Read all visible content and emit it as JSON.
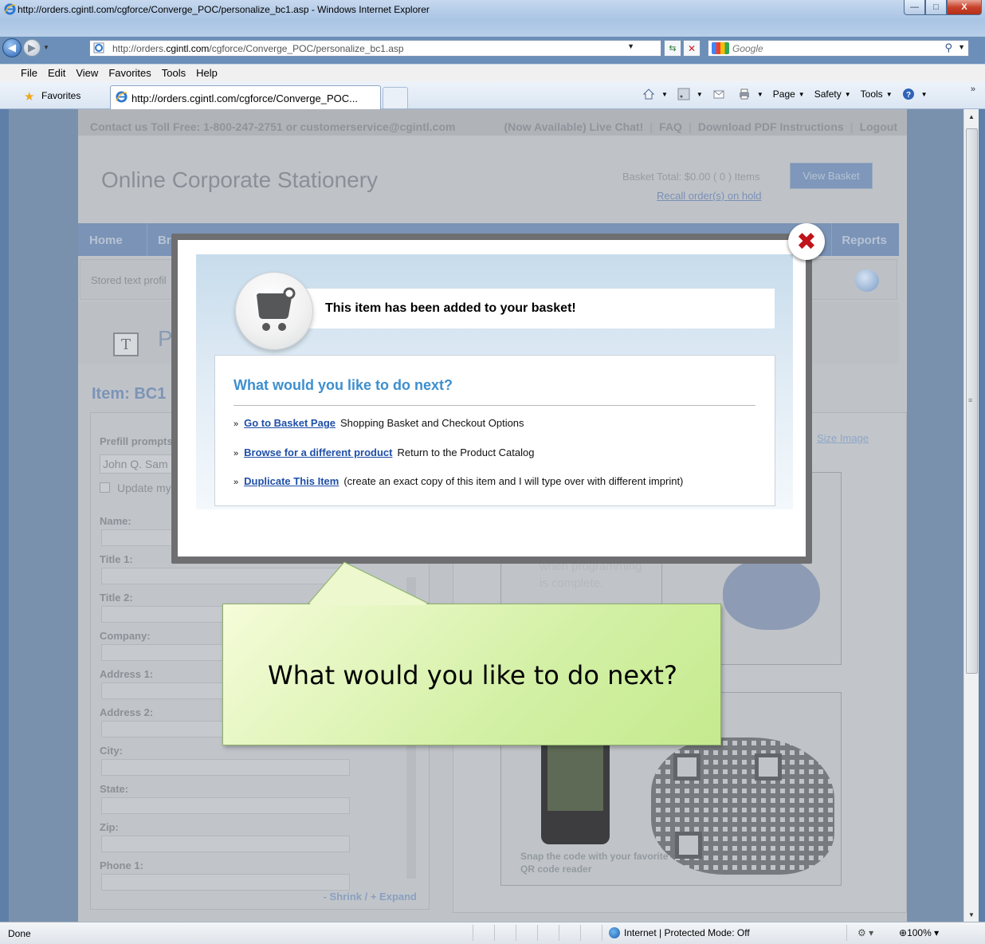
{
  "window": {
    "title": "http://orders.cgintl.com/cgforce/Converge_POC/personalize_bc1.asp - Windows Internet Explorer",
    "minimize": "—",
    "maximize": "□",
    "close": "X"
  },
  "address_bar": {
    "url_prefix": "http://orders.",
    "url_domain": "cgintl.com",
    "url_path": "/cgforce/Converge_POC/personalize_bc1.asp",
    "search_placeholder": "Google"
  },
  "menu": [
    "File",
    "Edit",
    "View",
    "Favorites",
    "Tools",
    "Help"
  ],
  "favorites_bar": {
    "favorites_label": "Favorites",
    "tab_title": "http://orders.cgintl.com/cgforce/Converge_POC...",
    "page_label": "Page",
    "safety_label": "Safety",
    "tools_label": "Tools"
  },
  "site": {
    "contact": "Contact us Toll Free: 1-800-247-2751 or customerservice@cgintl.com",
    "links": [
      "(Now Available) Live Chat!",
      "FAQ",
      "Download PDF Instructions",
      "Logout"
    ],
    "brand": "Online Corporate Stationery",
    "basket_total": "Basket Total: $0.00  ( 0 ) Items",
    "recall": "Recall order(s) on hold",
    "view_basket": "View Basket",
    "nav_home": "Home",
    "nav_b": "Br",
    "nav_reports": "Reports",
    "stored_text": "Stored text profil",
    "product_letter": "P",
    "item_label": "Item:  BC1",
    "prefill_label": "Prefill prompts",
    "prefill_value": "John Q. Sam",
    "update_label": "Update my",
    "fields": [
      "Name:",
      "Title 1:",
      "Title 2:",
      "Company:",
      "Address 1:",
      "Address 2:",
      "City:",
      "State:",
      "Zip:",
      "Phone 1:"
    ],
    "shrink_expand": "- Shrink / + Expand",
    "size_image": "Size Image",
    "card_text": "when programming\nis complete.",
    "snap_text": "Snap the code with your favorite",
    "snap_text2": "QR code reader"
  },
  "modal": {
    "added_message": "This item has been added to your basket!",
    "next_title": "What would you like to do next?",
    "options": [
      {
        "link": "Go to Basket Page",
        "desc": "Shopping Basket and Checkout Options"
      },
      {
        "link": "Browse for a different product",
        "desc": "Return to the Product Catalog"
      },
      {
        "link": "Duplicate This Item",
        "desc": "(create an exact copy of this item and I will type over with different imprint)"
      }
    ],
    "bullet": "»"
  },
  "callout": {
    "text": "What would you like to do next?"
  },
  "status_bar": {
    "status": "Done",
    "zone": "Internet | Protected Mode: Off",
    "zoom": "100%"
  }
}
